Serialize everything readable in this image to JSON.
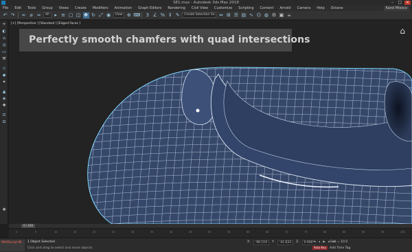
{
  "window": {
    "title": "SE1.max - Autodesk 3ds Max 2018"
  },
  "menu": {
    "items": [
      "File",
      "Edit",
      "Tools",
      "Group",
      "Views",
      "Create",
      "Modifiers",
      "Animation",
      "Graph Editors",
      "Rendering",
      "Civil View",
      "Customize",
      "Scripting",
      "Content",
      "Arnold",
      "Camera",
      "Help",
      "Octane"
    ],
    "user": "Karol Miesco"
  },
  "toolbar": {
    "filter_value": "All",
    "view_value": "View",
    "selection_set_placeholder": "Create Selection Se"
  },
  "viewport": {
    "label": "[+] [Perspective ] [Standard ] [Edged Faces ]",
    "headline": "Perfectly smooth chamfers with quad intersections",
    "colors": {
      "mesh_fill": "#36486a",
      "wire": "#c7d2e6",
      "highlight": "#7fd8ff",
      "bg": "#232323"
    }
  },
  "timeline": {
    "frame_slider": "0 / 100",
    "ticks": [
      "0",
      "5",
      "10",
      "15",
      "20",
      "25",
      "30",
      "35",
      "40",
      "45",
      "50",
      "55",
      "60",
      "65",
      "70",
      "75",
      "80",
      "85",
      "90",
      "95",
      "100"
    ]
  },
  "status": {
    "maxscript_label": "MAXScript Mi",
    "selection": "1 Object Selected",
    "hint": "Click and drag to select and move objects",
    "x_label": "X:",
    "x_value": "-96.119",
    "y_label": "Y:",
    "y_value": "-41.633",
    "z_label": "Z:",
    "z_value": "0.000",
    "grid": "Grid = 10.0",
    "auto_key": "Auto Key",
    "add_time_tag": "Add Time Tag"
  }
}
